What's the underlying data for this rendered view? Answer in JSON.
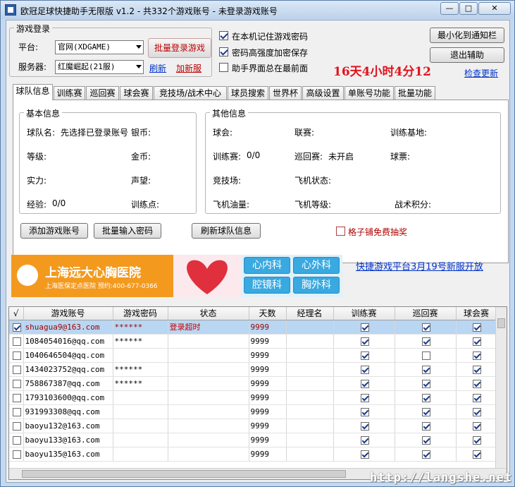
{
  "window": {
    "title": "欧冠足球快捷助手无限版 v1.2 - 共332个游戏账号 - 未登录游戏账号",
    "min_label": "—",
    "max_label": "□",
    "close_label": "✕"
  },
  "login_group": {
    "title": "游戏登录",
    "platform_label": "平台:",
    "platform_value": "官网(XDGAME)",
    "server_label": "服务器:",
    "server_value": "红魔崛起(21服)",
    "batch_login_button": "批量登录游戏",
    "refresh_link": "刷新",
    "new_server_link": "加新服"
  },
  "options": {
    "remember_password": "在本机记住游戏密码",
    "encrypt_password": "密码高强度加密保存",
    "always_on_top": "助手界面总在最前面"
  },
  "right_controls": {
    "minimize_tray_button": "最小化到通知栏",
    "exit_button": "退出辅助",
    "check_update_link": "检查更新",
    "timer_text": "16天4小时4分12"
  },
  "tabs": [
    "球队信息",
    "训练赛",
    "巡回赛",
    "球会赛",
    "竞技场/战术中心",
    "球员搜索",
    "世界杯",
    "高级设置",
    "单账号功能",
    "批量功能"
  ],
  "basic_info": {
    "title": "基本信息",
    "team_name_label": "球队名:",
    "team_name_value": "先选择已登录账号",
    "silver_label": "银币:",
    "level_label": "等级:",
    "gold_label": "金币:",
    "strength_label": "实力:",
    "reputation_label": "声望:",
    "exp_label": "经验:",
    "exp_value": "0/0",
    "training_points_label": "训练点:"
  },
  "other_info": {
    "title": "其他信息",
    "club_label": "球会:",
    "league_label": "联赛:",
    "training_base_label": "训练基地:",
    "training_match_label": "训练赛:",
    "training_match_value": "0/0",
    "tour_label": "巡回赛:",
    "tour_value": "未开启",
    "ticket_label": "球票:",
    "arena_label": "竞技场:",
    "plane_status_label": "飞机状态:",
    "plane_fuel_label": "飞机油量:",
    "plane_level_label": "飞机等级:",
    "tactics_points_label": "战术积分:"
  },
  "actions": {
    "add_account": "添加游戏账号",
    "batch_password": "批量输入密码",
    "refresh_team": "刷新球队信息",
    "free_lottery": "格子铺免费抽奖"
  },
  "banner": {
    "hospital_name": "上海远大心胸医院",
    "sub_text": "上海医保定点医院  预约:400-677-0366",
    "dept1": "心内科",
    "dept2": "心外科",
    "dept3": "腔镜科",
    "dept4": "胸外科",
    "accent": "#f39a1e"
  },
  "news_link": "快捷游戏平台3月19号新服开放",
  "table": {
    "columns": [
      "√",
      "游戏账号",
      "游戏密码",
      "状态",
      "天数",
      "经理名",
      "训练赛",
      "巡回赛",
      "球会赛"
    ],
    "rows": [
      {
        "checked": true,
        "account": "shuagua9@163.com",
        "password": "******",
        "status": "登录超时",
        "days": "9999",
        "manager": "",
        "train": true,
        "tour": true,
        "club": true
      },
      {
        "checked": false,
        "account": "1084054016@qq.com",
        "password": "******",
        "status": "",
        "days": "9999",
        "manager": "",
        "train": true,
        "tour": true,
        "club": true
      },
      {
        "checked": false,
        "account": "1040646504@qq.com",
        "password": "",
        "status": "",
        "days": "9999",
        "manager": "",
        "train": true,
        "tour": false,
        "club": true
      },
      {
        "checked": false,
        "account": "1434023752@qq.com",
        "password": "******",
        "status": "",
        "days": "9999",
        "manager": "",
        "train": true,
        "tour": true,
        "club": true
      },
      {
        "checked": false,
        "account": "758867387@qq.com",
        "password": "******",
        "status": "",
        "days": "9999",
        "manager": "",
        "train": true,
        "tour": true,
        "club": true
      },
      {
        "checked": false,
        "account": "1793103600@qq.com",
        "password": "",
        "status": "",
        "days": "9999",
        "manager": "",
        "train": true,
        "tour": true,
        "club": true
      },
      {
        "checked": false,
        "account": "931993308@qq.com",
        "password": "",
        "status": "",
        "days": "9999",
        "manager": "",
        "train": true,
        "tour": true,
        "club": true
      },
      {
        "checked": false,
        "account": "baoyu132@163.com",
        "password": "",
        "status": "",
        "days": "9999",
        "manager": "",
        "train": true,
        "tour": true,
        "club": true
      },
      {
        "checked": false,
        "account": "baoyu133@163.com",
        "password": "",
        "status": "",
        "days": "9999",
        "manager": "",
        "train": true,
        "tour": true,
        "club": true
      },
      {
        "checked": false,
        "account": "baoyu135@163.com",
        "password": "",
        "status": "",
        "days": "9999",
        "manager": "",
        "train": true,
        "tour": true,
        "club": true
      }
    ]
  },
  "watermark": "http://langshe.net",
  "colors": {
    "timer": "#e0141e",
    "status_red": "#c80000",
    "link_blue": "#0033cc",
    "selection": "#b9d6f2"
  }
}
